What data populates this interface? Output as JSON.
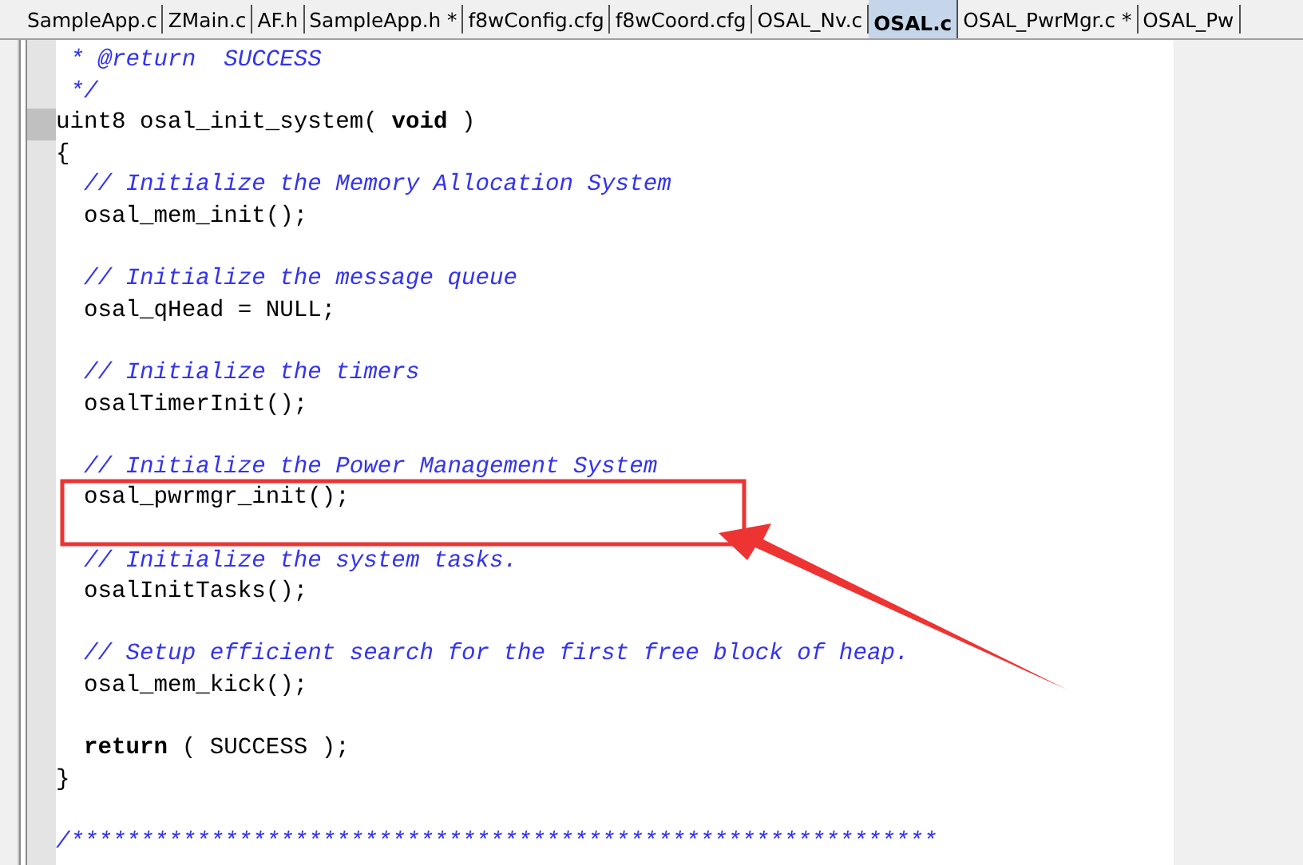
{
  "tabs": [
    {
      "label": "SampleApp.c",
      "selected": false
    },
    {
      "label": "ZMain.c",
      "selected": false
    },
    {
      "label": "AF.h",
      "selected": false
    },
    {
      "label": "SampleApp.h *",
      "selected": false
    },
    {
      "label": "f8wConfig.cfg",
      "selected": false
    },
    {
      "label": "f8wCoord.cfg",
      "selected": false
    },
    {
      "label": "OSAL_Nv.c",
      "selected": false
    },
    {
      "label": "OSAL.c",
      "selected": true
    },
    {
      "label": "OSAL_PwrMgr.c *",
      "selected": false
    },
    {
      "label": "OSAL_Pw",
      "selected": false
    }
  ],
  "editor": {
    "lines": [
      {
        "kind": "comment",
        "text": " * @return  SUCCESS",
        "current": false
      },
      {
        "kind": "comment",
        "text": " */",
        "current": false
      },
      {
        "kind": "code",
        "text": "uint8 osal_init_system( **void** )",
        "current": true
      },
      {
        "kind": "code",
        "text": "{",
        "current": false
      },
      {
        "kind": "comment",
        "text": "  // Initialize the Memory Allocation System",
        "current": false
      },
      {
        "kind": "code",
        "text": "  osal_mem_init();",
        "current": false
      },
      {
        "kind": "blank"
      },
      {
        "kind": "comment",
        "text": "  // Initialize the message queue",
        "current": false
      },
      {
        "kind": "code",
        "text": "  osal_qHead = NULL;",
        "current": false
      },
      {
        "kind": "blank"
      },
      {
        "kind": "comment",
        "text": "  // Initialize the timers",
        "current": false
      },
      {
        "kind": "code",
        "text": "  osalTimerInit();",
        "current": false
      },
      {
        "kind": "blank"
      },
      {
        "kind": "comment",
        "text": "  // Initialize the Power Management System",
        "current": false
      },
      {
        "kind": "code",
        "text": "  osal_pwrmgr_init();",
        "current": false
      },
      {
        "kind": "blank"
      },
      {
        "kind": "comment",
        "text": "  // Initialize the system tasks.",
        "current": false
      },
      {
        "kind": "code",
        "text": "  osalInitTasks();",
        "current": false
      },
      {
        "kind": "blank"
      },
      {
        "kind": "comment",
        "text": "  // Setup efficient search for the first free block of heap.",
        "current": false
      },
      {
        "kind": "code",
        "text": "  osal_mem_kick();",
        "current": false
      },
      {
        "kind": "blank"
      },
      {
        "kind": "code",
        "text": "  **return** ( SUCCESS );",
        "current": false
      },
      {
        "kind": "code",
        "text": "}",
        "current": false
      },
      {
        "kind": "blank"
      },
      {
        "kind": "comment",
        "text": "/**************************************************************",
        "current": false
      }
    ]
  }
}
